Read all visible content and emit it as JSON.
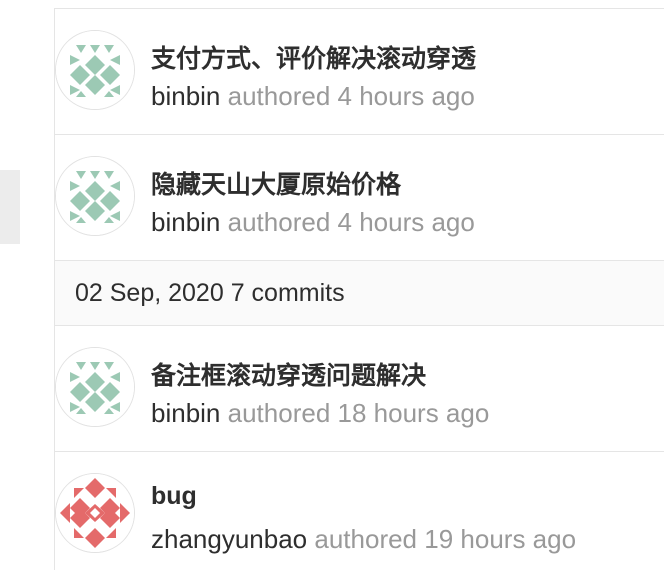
{
  "commits_before": [
    {
      "title": "支付方式、评价解决滚动穿透",
      "author": "binbin",
      "authored_text": "authored",
      "time": "4 hours ago",
      "avatar": "binbin-identicon"
    },
    {
      "title": "隐藏天山大厦原始价格",
      "author": "binbin",
      "authored_text": "authored",
      "time": "4 hours ago",
      "avatar": "binbin-identicon"
    }
  ],
  "day_header": {
    "label": "02 Sep, 2020 7 commits"
  },
  "commits_after": [
    {
      "title": "备注框滚动穿透问题解决",
      "author": "binbin",
      "authored_text": "authored",
      "time": "18 hours ago",
      "avatar": "binbin-identicon"
    },
    {
      "title": "bug",
      "author": "zhangyunbao",
      "authored_text": "authored",
      "time": "19 hours ago",
      "avatar": "zhangyunbao-identicon"
    }
  ],
  "colors": {
    "binbin_avatar": "#9cc9b4",
    "zhangyunbao_avatar": "#e46a6a",
    "title_text": "#2e2e2e",
    "meta_text": "#999999",
    "border": "#e5e5e5",
    "day_header_bg": "#fafafa"
  }
}
